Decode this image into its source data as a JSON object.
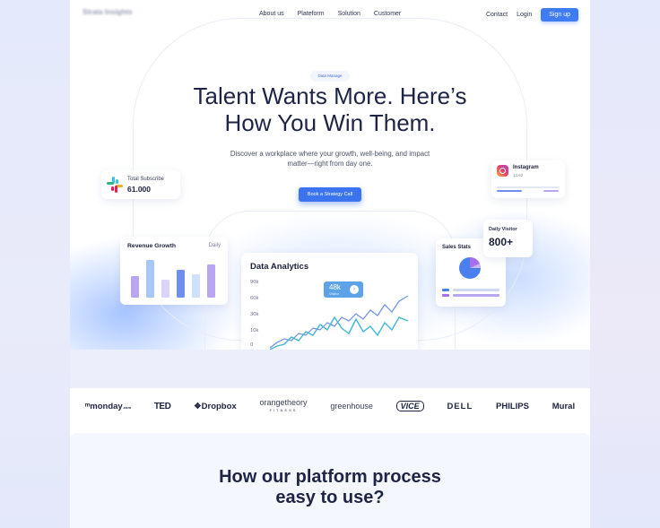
{
  "nav": {
    "logo_text": "Strata Insights",
    "links": [
      "About us",
      "Plateform",
      "Solution",
      "Customer"
    ],
    "contact": "Contact",
    "login": "Login",
    "signup": "Sign up"
  },
  "hero": {
    "eyebrow": "Data Manage",
    "title_line1": "Talent Wants More. Here’s",
    "title_line2": "How You Win Them.",
    "subtitle_line1": "Discover a workplace where your growth, well-being, and impact",
    "subtitle_line2": "matter—right from day one.",
    "cta": "Book a Strategy Call"
  },
  "widgets": {
    "subscribe": {
      "label": "Total Subscribe",
      "value": "61.000",
      "icon": "slack-icon"
    },
    "instagram": {
      "name": "Instagram",
      "count": "13,62",
      "icon": "instagram-icon"
    },
    "revenue": {
      "title": "Revenue Growth",
      "period": "Daily",
      "bars": [
        0.55,
        0.95,
        0.45,
        0.7,
        0.6,
        0.85
      ]
    },
    "analytics": {
      "title": "Data Analytics",
      "ticks": [
        "90k",
        "60k",
        "30k",
        "10k",
        "0"
      ],
      "tooltip_value": "48k",
      "tooltip_sub": "Visitor"
    },
    "sales": {
      "title": "Sales Stats"
    },
    "visitor": {
      "label": "Daily Visitor",
      "value": "800+"
    }
  },
  "brands": [
    "monday",
    ".com",
    "TED",
    "Dropbox",
    "orangetheory",
    "FITNESS",
    "greenhouse",
    "VICE",
    "DELL",
    "PHILIPS",
    "Mural"
  ],
  "process": {
    "title_line1": "How our platform process",
    "title_line2": "easy to use?"
  },
  "colors": {
    "accent": "#3f7bf2",
    "text_dark": "#1e2446",
    "chart_line_primary": "#3fb6d6",
    "chart_line_secondary": "#6f8ff0",
    "bar_purple": "#b9a6f0",
    "bar_blue": "#6f8ff0"
  }
}
